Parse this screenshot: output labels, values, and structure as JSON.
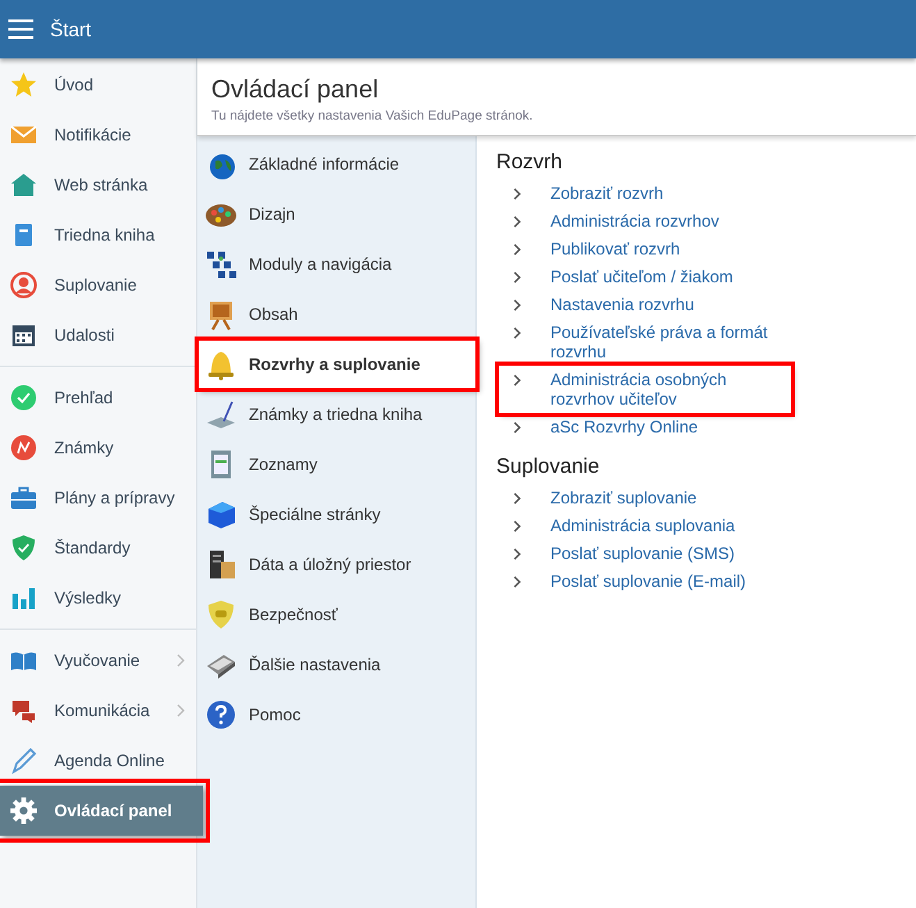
{
  "header": {
    "title": "Štart"
  },
  "sidebar": {
    "groups": [
      {
        "items": [
          {
            "label": "Úvod",
            "selected": false,
            "highlighted": false,
            "has_submenu": false
          },
          {
            "label": "Notifikácie",
            "selected": false,
            "highlighted": false,
            "has_submenu": false
          },
          {
            "label": "Web stránka",
            "selected": false,
            "highlighted": false,
            "has_submenu": false
          },
          {
            "label": "Triedna kniha",
            "selected": false,
            "highlighted": false,
            "has_submenu": false
          },
          {
            "label": "Suplovanie",
            "selected": false,
            "highlighted": false,
            "has_submenu": false
          },
          {
            "label": "Udalosti",
            "selected": false,
            "highlighted": false,
            "has_submenu": false
          }
        ]
      },
      {
        "items": [
          {
            "label": "Prehľad",
            "selected": false,
            "highlighted": false,
            "has_submenu": false
          },
          {
            "label": "Známky",
            "selected": false,
            "highlighted": false,
            "has_submenu": false
          },
          {
            "label": "Plány a prípravy",
            "selected": false,
            "highlighted": false,
            "has_submenu": false
          },
          {
            "label": "Štandardy",
            "selected": false,
            "highlighted": false,
            "has_submenu": false
          },
          {
            "label": "Výsledky",
            "selected": false,
            "highlighted": false,
            "has_submenu": false
          }
        ]
      },
      {
        "items": [
          {
            "label": "Vyučovanie",
            "selected": false,
            "highlighted": false,
            "has_submenu": true
          },
          {
            "label": "Komunikácia",
            "selected": false,
            "highlighted": false,
            "has_submenu": true
          },
          {
            "label": "Agenda Online",
            "selected": false,
            "highlighted": false,
            "has_submenu": false
          },
          {
            "label": "Ovládací panel",
            "selected": true,
            "highlighted": true,
            "has_submenu": false
          }
        ]
      }
    ]
  },
  "page": {
    "title": "Ovládací panel",
    "subtitle": "Tu nájdete všetky nastavenia Vašich EduPage stránok."
  },
  "categories": [
    {
      "label": "Základné informácie",
      "selected": false,
      "highlighted": false
    },
    {
      "label": "Dizajn",
      "selected": false,
      "highlighted": false
    },
    {
      "label": "Moduly a navigácia",
      "selected": false,
      "highlighted": false
    },
    {
      "label": "Obsah",
      "selected": false,
      "highlighted": false
    },
    {
      "label": "Rozvrhy a suplovanie",
      "selected": true,
      "highlighted": true
    },
    {
      "label": "Známky a triedna kniha",
      "selected": false,
      "highlighted": false
    },
    {
      "label": "Zoznamy",
      "selected": false,
      "highlighted": false
    },
    {
      "label": "Špeciálne stránky",
      "selected": false,
      "highlighted": false
    },
    {
      "label": "Dáta a úložný priestor",
      "selected": false,
      "highlighted": false
    },
    {
      "label": "Bezpečnosť",
      "selected": false,
      "highlighted": false
    },
    {
      "label": "Ďalšie nastavenia",
      "selected": false,
      "highlighted": false
    },
    {
      "label": "Pomoc",
      "selected": false,
      "highlighted": false
    }
  ],
  "sections": [
    {
      "heading": "Rozvrh",
      "links": [
        {
          "label": "Zobraziť rozvrh",
          "highlighted": false
        },
        {
          "label": "Administrácia rozvrhov",
          "highlighted": false
        },
        {
          "label": "Publikovať rozvrh",
          "highlighted": false
        },
        {
          "label": "Poslať učiteľom / žiakom",
          "highlighted": false
        },
        {
          "label": "Nastavenia rozvrhu",
          "highlighted": false
        },
        {
          "label": "Používateľské práva a formát rozvrhu",
          "highlighted": false
        },
        {
          "label": "Administrácia osobných rozvrhov učiteľov",
          "highlighted": true
        },
        {
          "label": "aSc Rozvrhy Online",
          "highlighted": false
        }
      ]
    },
    {
      "heading": "Suplovanie",
      "links": [
        {
          "label": "Zobraziť suplovanie",
          "highlighted": false
        },
        {
          "label": "Administrácia suplovania",
          "highlighted": false
        },
        {
          "label": "Poslať suplovanie (SMS)",
          "highlighted": false
        },
        {
          "label": "Poslať suplovanie (E-mail)",
          "highlighted": false
        }
      ]
    }
  ]
}
